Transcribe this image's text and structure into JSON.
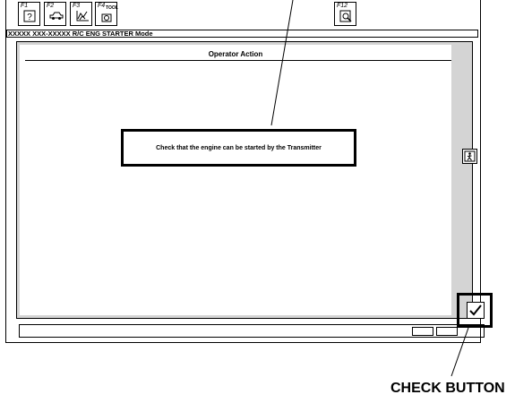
{
  "toolbar": {
    "f1": {
      "key": "F1",
      "icon": "help-icon"
    },
    "f2": {
      "key": "F2",
      "icon": "vehicle-icon"
    },
    "f3": {
      "key": "F3",
      "icon": "graph-icon"
    },
    "f4": {
      "key": "F4",
      "tag": "TOOL",
      "icon": "tool-icon"
    },
    "f12": {
      "key": "F12",
      "icon": "print-preview-icon"
    }
  },
  "mode_bar": {
    "text": "XXXXX XXX-XXXXX  R/C ENG STARTER Mode"
  },
  "panel": {
    "title": "Operator Action",
    "message": "Check that the engine can be started by the  Transmitter"
  },
  "side_button": {
    "icon": "exit-icon"
  },
  "check_button": {
    "icon": "checkmark-icon"
  },
  "callout": {
    "label": "CHECK BUTTON"
  }
}
